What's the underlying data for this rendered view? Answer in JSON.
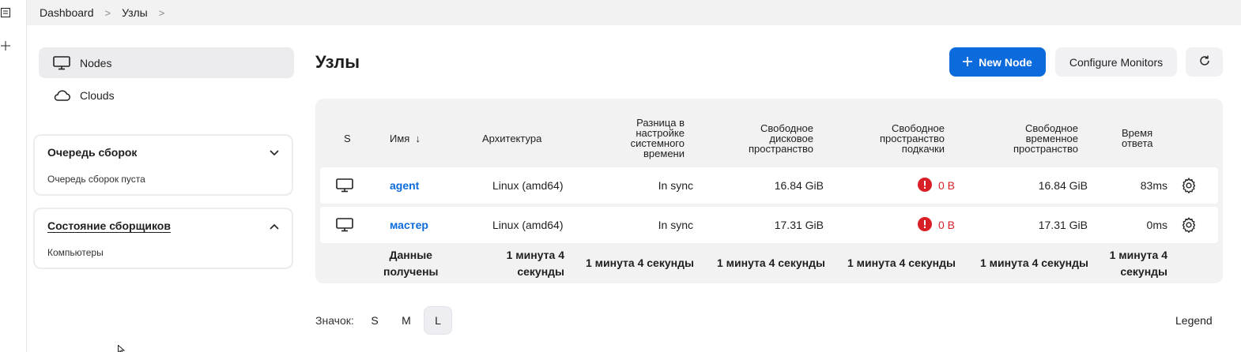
{
  "breadcrumb": {
    "items": [
      "Dashboard",
      "Узлы"
    ],
    "separator": ">"
  },
  "sidebar": {
    "nav": [
      {
        "label": "Nodes",
        "icon": "monitor-icon",
        "active": true
      },
      {
        "label": "Clouds",
        "icon": "cloud-icon",
        "active": false
      }
    ],
    "build_queue": {
      "title": "Очередь сборок",
      "body": "Очередь сборок пуста",
      "icon": "chevron-down-icon"
    },
    "executors": {
      "title": "Состояние сборщиков",
      "body": "Компьютеры",
      "icon": "chevron-up-icon"
    }
  },
  "main": {
    "title": "Узлы",
    "new_node": "New Node",
    "configure": "Configure Monitors",
    "refresh_icon": "refresh-icon"
  },
  "table": {
    "headers": {
      "s": "S",
      "name": "Имя  ↓",
      "arch": "Архитектура",
      "clock": [
        "Разница в",
        "настройке",
        "системного",
        "времени"
      ],
      "disk": [
        "Свободное",
        "дисковое",
        "пространство"
      ],
      "swap": [
        "Свободное",
        "пространство",
        "подкачки"
      ],
      "temp": [
        "Свободное",
        "временное",
        "пространство"
      ],
      "resp": [
        "Время",
        "ответа"
      ]
    },
    "rows": [
      {
        "name": "agent",
        "arch": "Linux (amd64)",
        "clock": "In sync",
        "disk": "16.84 GiB",
        "swap": "0 B",
        "temp": "16.84 GiB",
        "resp": "83ms"
      },
      {
        "name": "мастер",
        "arch": "Linux (amd64)",
        "clock": "In sync",
        "disk": "17.31 GiB",
        "swap": "0 B",
        "temp": "17.31 GiB",
        "resp": "0ms"
      }
    ],
    "footer": {
      "label": [
        "Данные",
        "получены"
      ],
      "arch": [
        "1 минута 4",
        "секунды"
      ],
      "clock": "1 минута 4 секунды",
      "disk": "1 минута 4 секунды",
      "swap": "1 минута 4 секунды",
      "temp": "1 минута 4 секунды",
      "resp": [
        "1 минута 4",
        "секунды"
      ]
    }
  },
  "icon_size": {
    "label": "Значок:",
    "options": [
      "S",
      "M",
      "L"
    ],
    "selected": "L"
  },
  "legend": "Legend",
  "colors": {
    "primary": "#0b6bdc",
    "error": "#d91f26",
    "panel": "#f2f2f3"
  }
}
